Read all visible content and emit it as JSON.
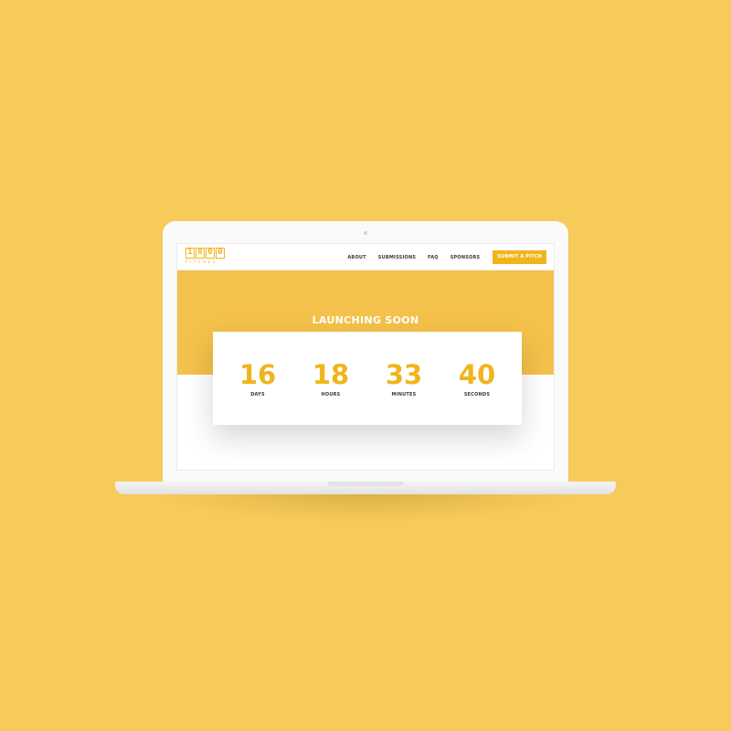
{
  "colors": {
    "background": "#f7cb5a",
    "accent": "#f0b51d",
    "hero": "#f4c14a",
    "text_dark": "#3a3a3a"
  },
  "logo": {
    "digits": [
      "1",
      "0",
      "0",
      "0"
    ],
    "subtitle": "PITCHES"
  },
  "nav": {
    "items": [
      {
        "label": "ABOUT"
      },
      {
        "label": "SUBMISSIONS"
      },
      {
        "label": "FAQ"
      },
      {
        "label": "SPONSORS"
      }
    ],
    "cta_label": "SUBMIT A PITCH"
  },
  "hero": {
    "title": "LAUNCHING SOON"
  },
  "countdown": {
    "units": [
      {
        "value": "16",
        "label": "DAYS"
      },
      {
        "value": "18",
        "label": "HOURS"
      },
      {
        "value": "33",
        "label": "MINUTES"
      },
      {
        "value": "40",
        "label": "SECONDS"
      }
    ]
  }
}
